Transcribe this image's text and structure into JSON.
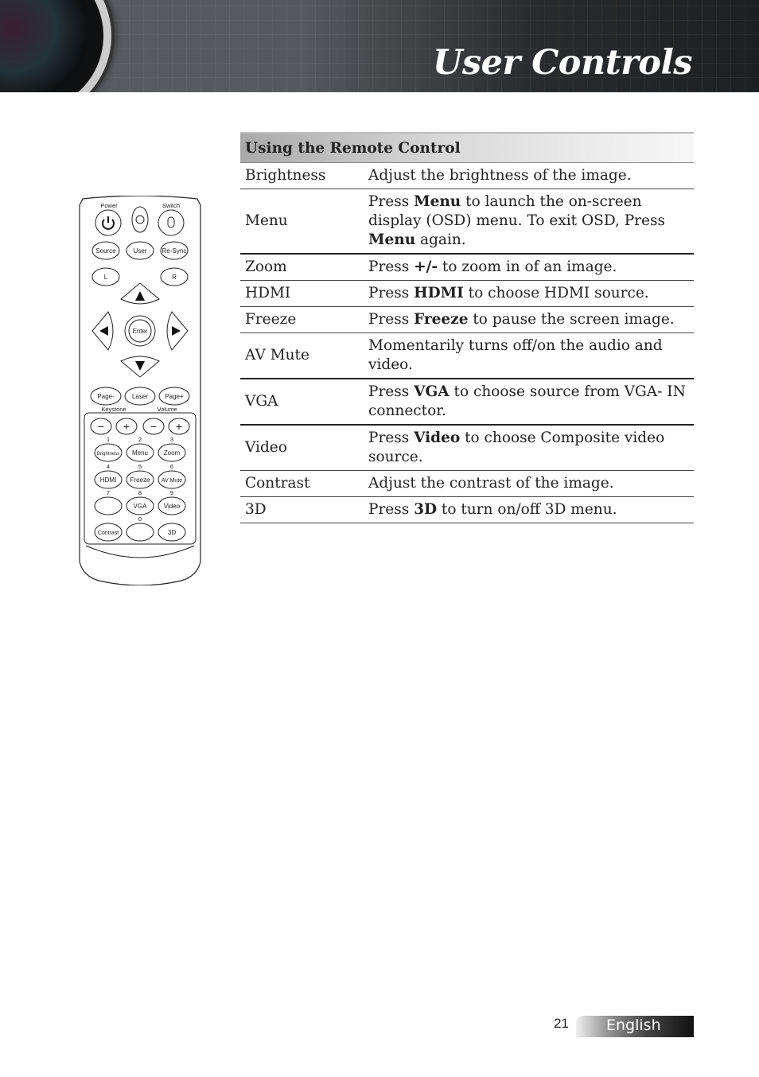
{
  "header": {
    "title": "User Controls"
  },
  "remote": {
    "top_labels": {
      "power": "Power",
      "switch": "Switch"
    },
    "row1": [
      "Source",
      "User",
      "Re-Sync"
    ],
    "row2": [
      "L",
      "R"
    ],
    "enter": "Enter",
    "row3": [
      "Page-",
      "Laser",
      "Page+"
    ],
    "group_labels": {
      "keystone": "Keystone",
      "volume": "Volume"
    },
    "minus_plus": [
      "−",
      "+",
      "−",
      "+"
    ],
    "numbers": [
      "1",
      "2",
      "3",
      "4",
      "5",
      "6",
      "7",
      "8",
      "9",
      "0"
    ],
    "row5": [
      "Brightness",
      "Menu",
      "Zoom"
    ],
    "row6": [
      "HDMI",
      "Freeze",
      "AV Mute"
    ],
    "row7": [
      "",
      "VGA",
      "Video"
    ],
    "row8": [
      "Contrast",
      "",
      "3D"
    ]
  },
  "table": {
    "heading": "Using the Remote Control",
    "rows": [
      {
        "key": "Brightness",
        "parts": [
          [
            "",
            "Adjust the brightness of the image."
          ]
        ]
      },
      {
        "key": "Menu",
        "parts": [
          [
            "",
            "Press "
          ],
          [
            "b",
            "Menu"
          ],
          [
            "",
            " to launch the on-screen display (OSD) menu. To exit OSD, Press "
          ],
          [
            "b",
            "Menu"
          ],
          [
            "",
            " again."
          ]
        ]
      },
      {
        "key": "Zoom",
        "parts": [
          [
            "",
            "Press "
          ],
          [
            "b",
            "+/-"
          ],
          [
            "",
            " to zoom in of an image."
          ]
        ]
      },
      {
        "key": "HDMI",
        "parts": [
          [
            "",
            "Press "
          ],
          [
            "b",
            "HDMI"
          ],
          [
            "",
            " to choose HDMI source."
          ]
        ]
      },
      {
        "key": "Freeze",
        "parts": [
          [
            "",
            "Press "
          ],
          [
            "b",
            "Freeze"
          ],
          [
            "",
            " to pause the screen image."
          ]
        ]
      },
      {
        "key": "AV Mute",
        "parts": [
          [
            "",
            "Momentarily turns off/on the audio and video."
          ]
        ]
      },
      {
        "key": "VGA",
        "parts": [
          [
            "",
            "Press "
          ],
          [
            "b",
            "VGA"
          ],
          [
            "",
            " to choose source from VGA- IN connector."
          ]
        ]
      },
      {
        "key": "Video",
        "parts": [
          [
            "",
            "Press "
          ],
          [
            "b",
            "Video"
          ],
          [
            "",
            " to choose Composite video source."
          ]
        ]
      },
      {
        "key": "Contrast",
        "parts": [
          [
            "",
            "Adjust the contrast of the image."
          ]
        ]
      },
      {
        "key": "3D",
        "parts": [
          [
            "",
            "Press "
          ],
          [
            "b",
            "3D"
          ],
          [
            "",
            " to turn on/off 3D menu."
          ]
        ]
      }
    ]
  },
  "footer": {
    "page_number": "21",
    "language": "English"
  }
}
